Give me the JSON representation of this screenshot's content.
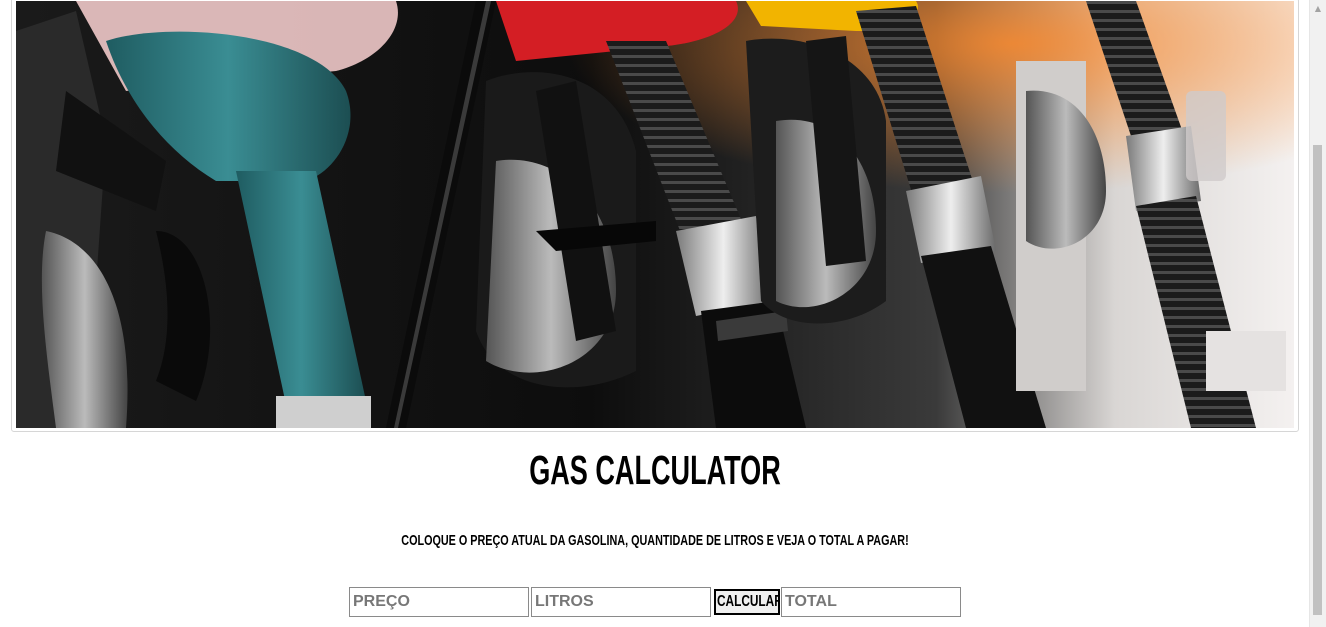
{
  "hero": {
    "icon": "fuel-pump-nozzles-photo",
    "colors": {
      "teal": "#2f7b80",
      "red": "#d41e24",
      "yellow": "#f2b400",
      "dark": "#141414",
      "chrome": "#c9c9c9"
    }
  },
  "header": {
    "title": "GAS CALCULATOR",
    "subtitle": "COLOQUE O PREÇO ATUAL DA GASOLINA, QUANTIDADE DE LITROS E VEJA O TOTAL A PAGAR!"
  },
  "form": {
    "price": {
      "placeholder": "PREÇO",
      "value": ""
    },
    "liters": {
      "placeholder": "LITROS",
      "value": ""
    },
    "calculate_label": "CALCULAR",
    "total": {
      "placeholder": "TOTAL",
      "value": ""
    }
  }
}
